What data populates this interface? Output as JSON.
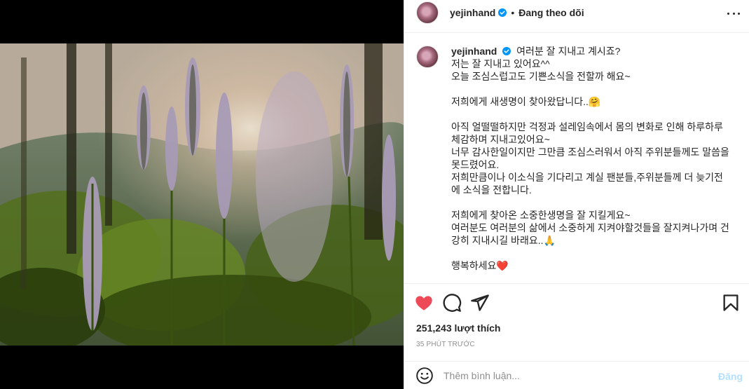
{
  "post": {
    "author": {
      "username": "yejinhand",
      "verified": true,
      "follow_status": "Đang theo dõi",
      "avatar": "profile-avatar"
    },
    "caption": {
      "username": "yejinhand",
      "text": "여러분 잘 지내고 계시죠?\n저는 잘 지내고 있어요^^\n오늘 조심스럽고도 기쁜소식을 전할까 해요~\n\n저희에게 새생명이 찾아왔답니다..🤗\n\n아직 얼떨떨하지만 걱정과 설레임속에서 몸의 변화로 인해 하루하루 체감하며 지내고있어요~\n너무 감사한일이지만 그만큼 조심스러워서 아직 주위분들께도 말씀을못드렸어요.\n저희만큼이나 이소식을 기다리고 계실 팬분들,주위분들께 더 늦기전에 소식을 전합니다.\n\n저희에게 찾아온 소중한생명을 잘 지킬게요~\n여러분도 여러분의 삶에서 소중하게 지켜야할것들을 잘지켜나가며 건강히 지내시길 바래요..🙏\n\n행복하세요❤️"
    },
    "likes": "251,243 lượt thích",
    "time_ago": "35 PHÚT TRƯỚC",
    "comment": {
      "placeholder": "Thêm bình luận...",
      "post_label": "Đăng"
    },
    "icons": {
      "like": "heart-filled-icon",
      "comment": "comment-bubble-icon",
      "share": "paper-plane-icon",
      "save": "bookmark-icon",
      "more": "more-dots-icon",
      "emoji": "smiley-icon",
      "verified": "verified-badge-icon"
    },
    "colors": {
      "like_red": "#ed4956",
      "verified_blue": "#0095f6",
      "post_disabled": "#b2dffc",
      "muted_text": "#8e8e8e"
    }
  }
}
